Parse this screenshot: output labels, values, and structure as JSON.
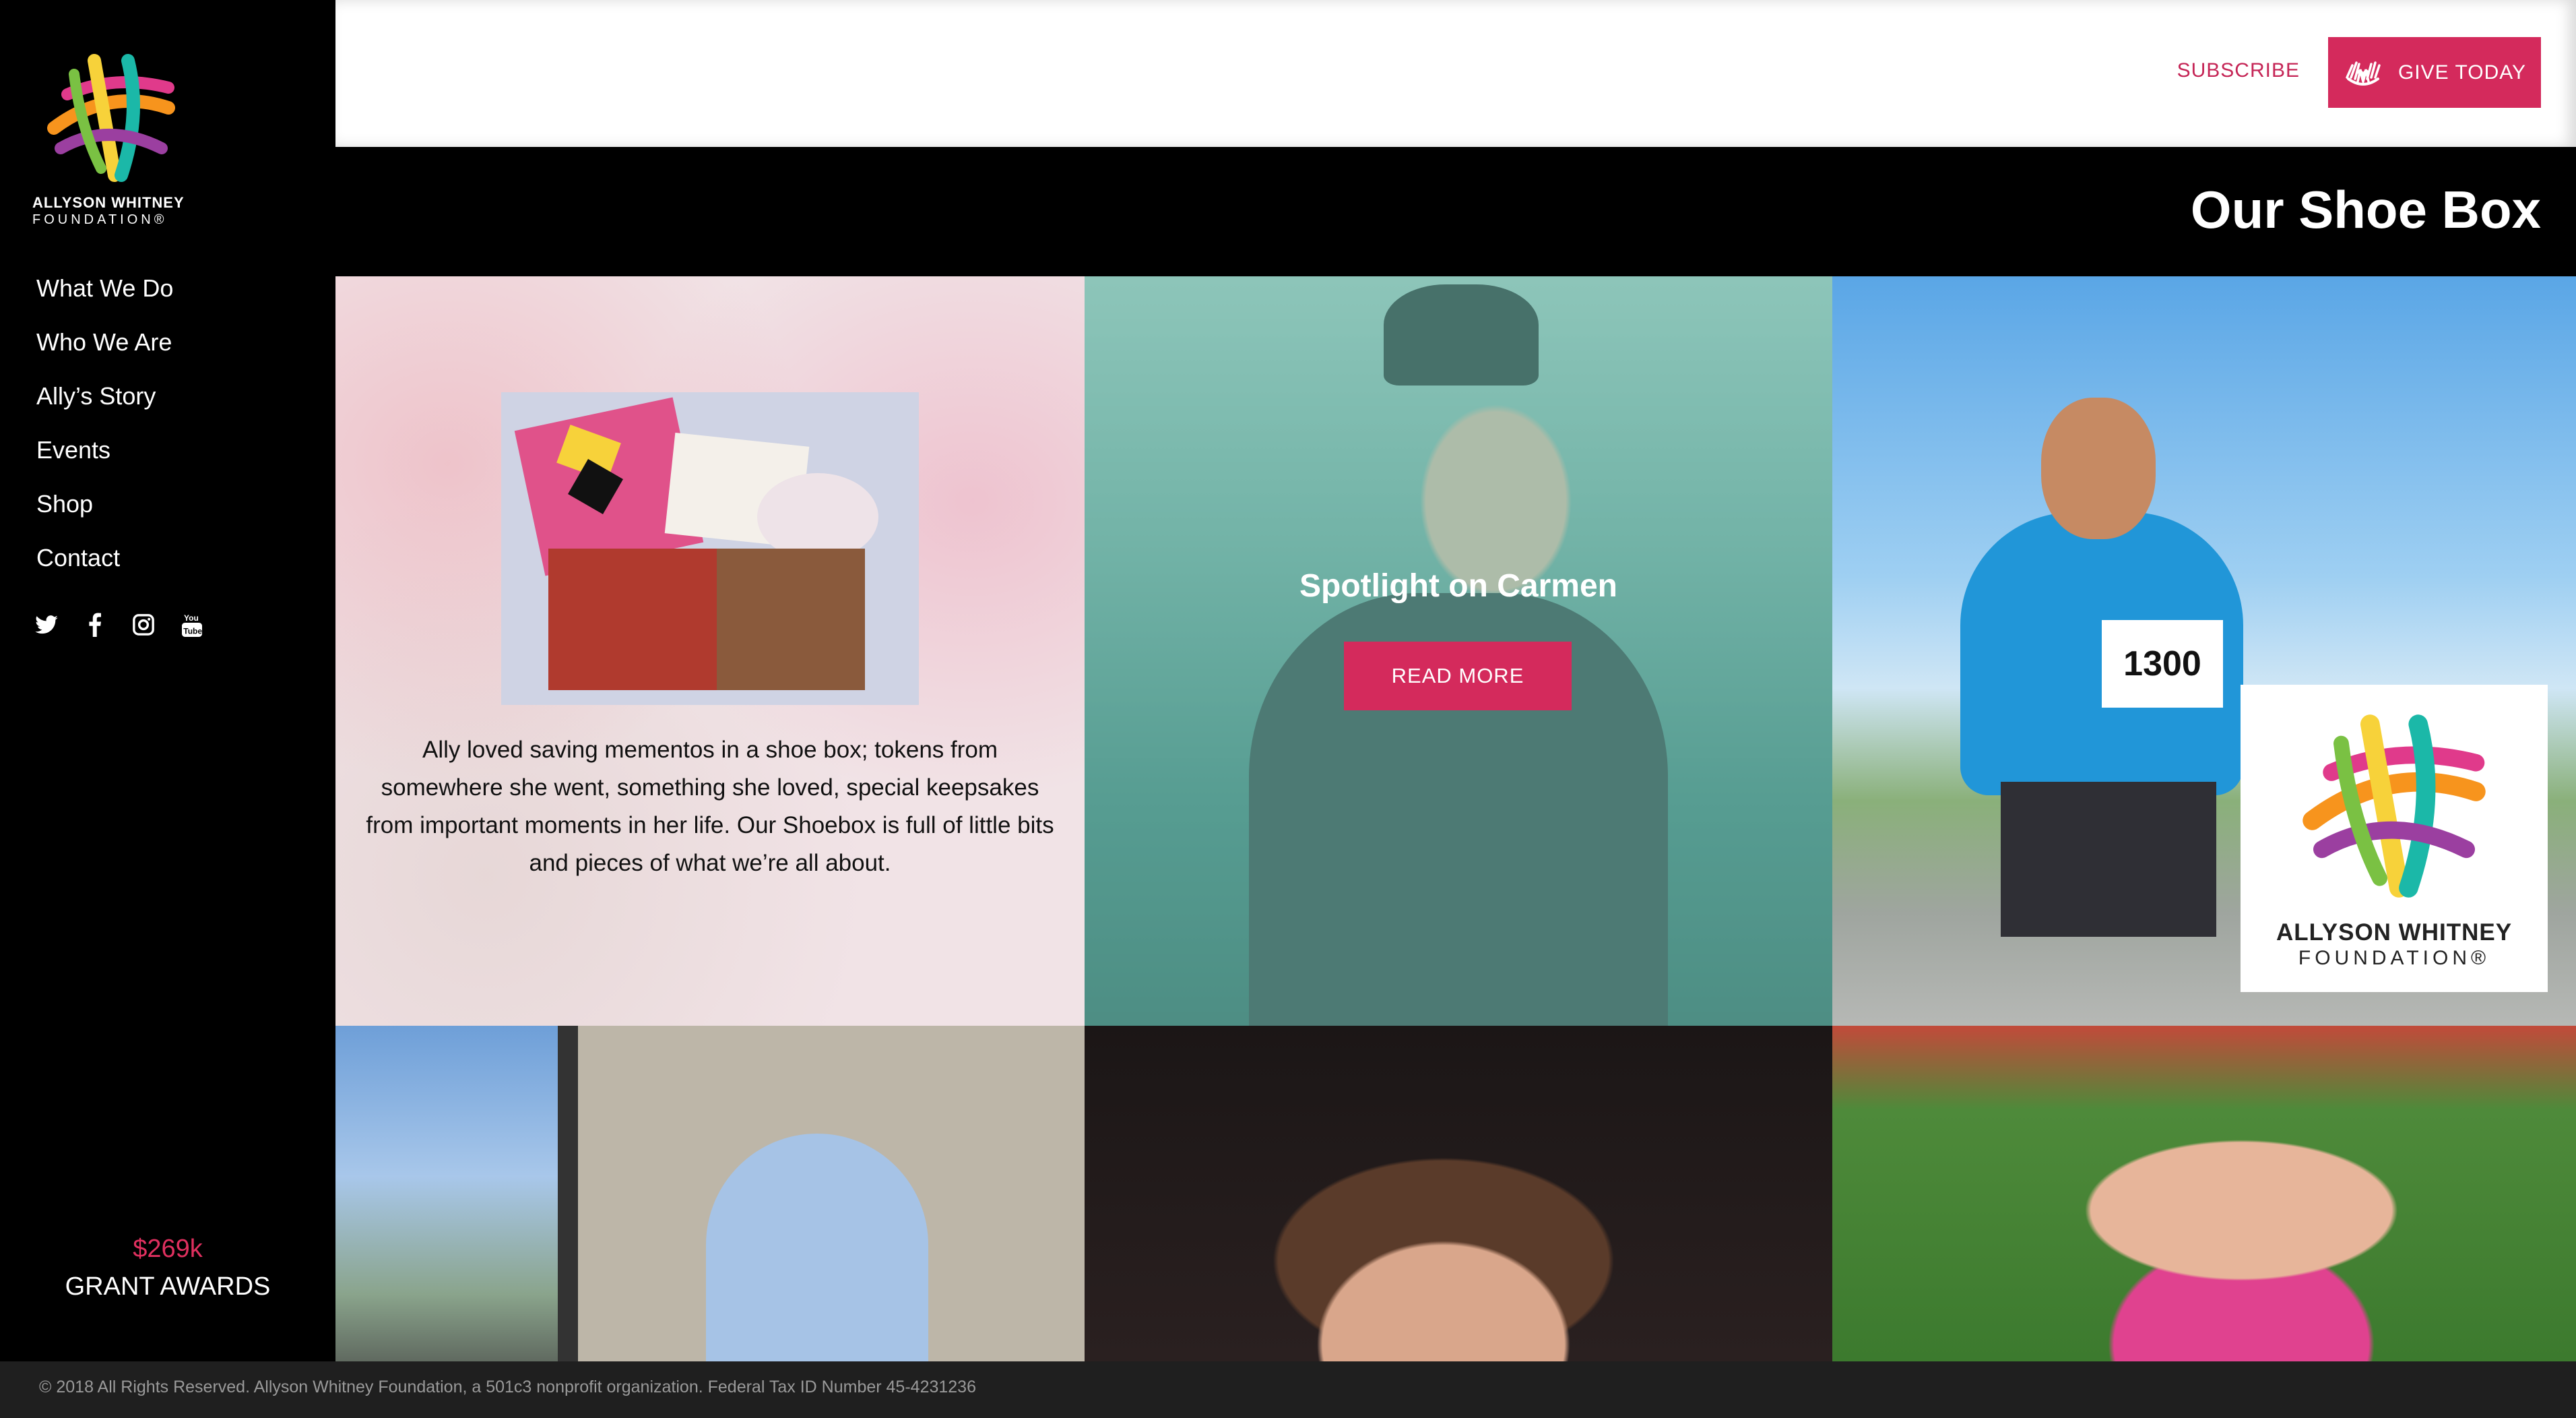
{
  "brand": {
    "name_line1": "ALLYSON WHITNEY",
    "name_line2": "FOUNDATION®",
    "colors": {
      "accent": "#d42a5c",
      "sidebar_bg": "#000000",
      "footer_bg": "#1f1f1f"
    }
  },
  "sidebar": {
    "nav": [
      {
        "label": "What We Do"
      },
      {
        "label": "Who We Are"
      },
      {
        "label": "Ally’s Story"
      },
      {
        "label": "Events"
      },
      {
        "label": "Shop"
      },
      {
        "label": "Contact"
      }
    ],
    "social": [
      "twitter-icon",
      "facebook-icon",
      "instagram-icon",
      "youtube-icon"
    ],
    "grant": {
      "amount": "$269k",
      "label": "GRANT AWARDS"
    }
  },
  "header": {
    "subscribe": "SUBSCRIBE",
    "give": "GIVE TODAY"
  },
  "page": {
    "title": "Our Shoe Box"
  },
  "tiles": {
    "intro": "Ally loved saving mementos in a shoe box; tokens from somewhere she went, something she loved, special keepsakes from important moments in her life. Our Shoebox is full of little bits and pieces of what we’re all about.",
    "spotlight": {
      "title": "Spotlight on Carmen",
      "button": "READ MORE"
    },
    "bib_number": "1300",
    "card_line1": "ALLYSON WHITNEY",
    "card_line2": "FOUNDATION®"
  },
  "footer": {
    "text": "© 2018 All Rights Reserved. Allyson Whitney Foundation, a 501c3 nonprofit organization. Federal Tax ID Number 45-4231236"
  }
}
